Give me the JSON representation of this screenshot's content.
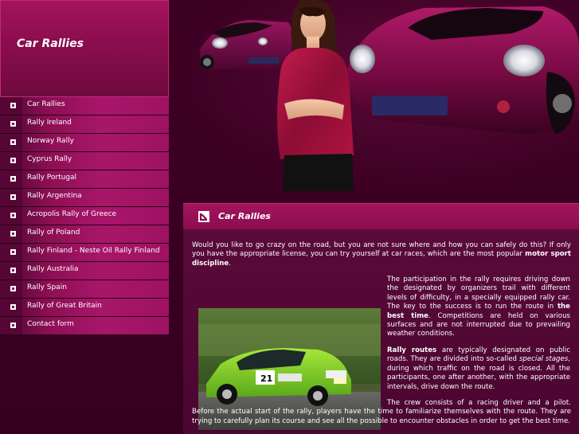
{
  "site": {
    "title": "Car Rallies"
  },
  "sidebar": {
    "items": [
      {
        "label": "Car Rallies"
      },
      {
        "label": "Rally Ireland"
      },
      {
        "label": "Norway Rally"
      },
      {
        "label": "Cyprus Rally"
      },
      {
        "label": "Rally Portugal"
      },
      {
        "label": "Rally Argentina"
      },
      {
        "label": "Acropolis Rally of Greece"
      },
      {
        "label": "Rally of Poland"
      },
      {
        "label": "Rally Finland - Neste Oil Rally Finland"
      },
      {
        "label": "Rally Australia"
      },
      {
        "label": "Rally Spain"
      },
      {
        "label": "Rally of Great Britain"
      },
      {
        "label": "Contact form"
      }
    ]
  },
  "content": {
    "title": "Car Rallies",
    "p1": {
      "a": "Would you like to go crazy on the road, but you are not sure where and how you can safely do this? If only you have the appropriate license, you can try yourself at car races, which are the most popular ",
      "b": "motor sport discipline",
      "c": "."
    },
    "p2": {
      "a": "The participation in the rally requires driving down the designated by organizers trail with different levels of difficulty, in a specially equipped rally car. The key to the success is to run the route in ",
      "b": "the best time",
      "c": ". Competitions are held on various surfaces and are not interrupted due to prevailing weather conditions."
    },
    "p3": {
      "a_bold": "Rally routes",
      "b": " are typically designated on public roads. They are divided into so-called ",
      "c_italic": "special stages",
      "d": ", during which traffic on the road is closed. All the participants, one after another, with the appropriate intervals, drive down the route."
    },
    "p4": {
      "a": "The crew consists of a racing driver and a pilot. Before the actual start of the rally, players have the time to familiarize themselves with the route. They are trying to carefully plan its course and see all the possible to encounter obstacles in order to get the best time."
    },
    "photo": {
      "car_number": "21"
    }
  },
  "colors": {
    "background": "#3d0024",
    "accent": "#a4135d",
    "menu_gradient_end": "#a8166a",
    "text": "#ffffff"
  }
}
